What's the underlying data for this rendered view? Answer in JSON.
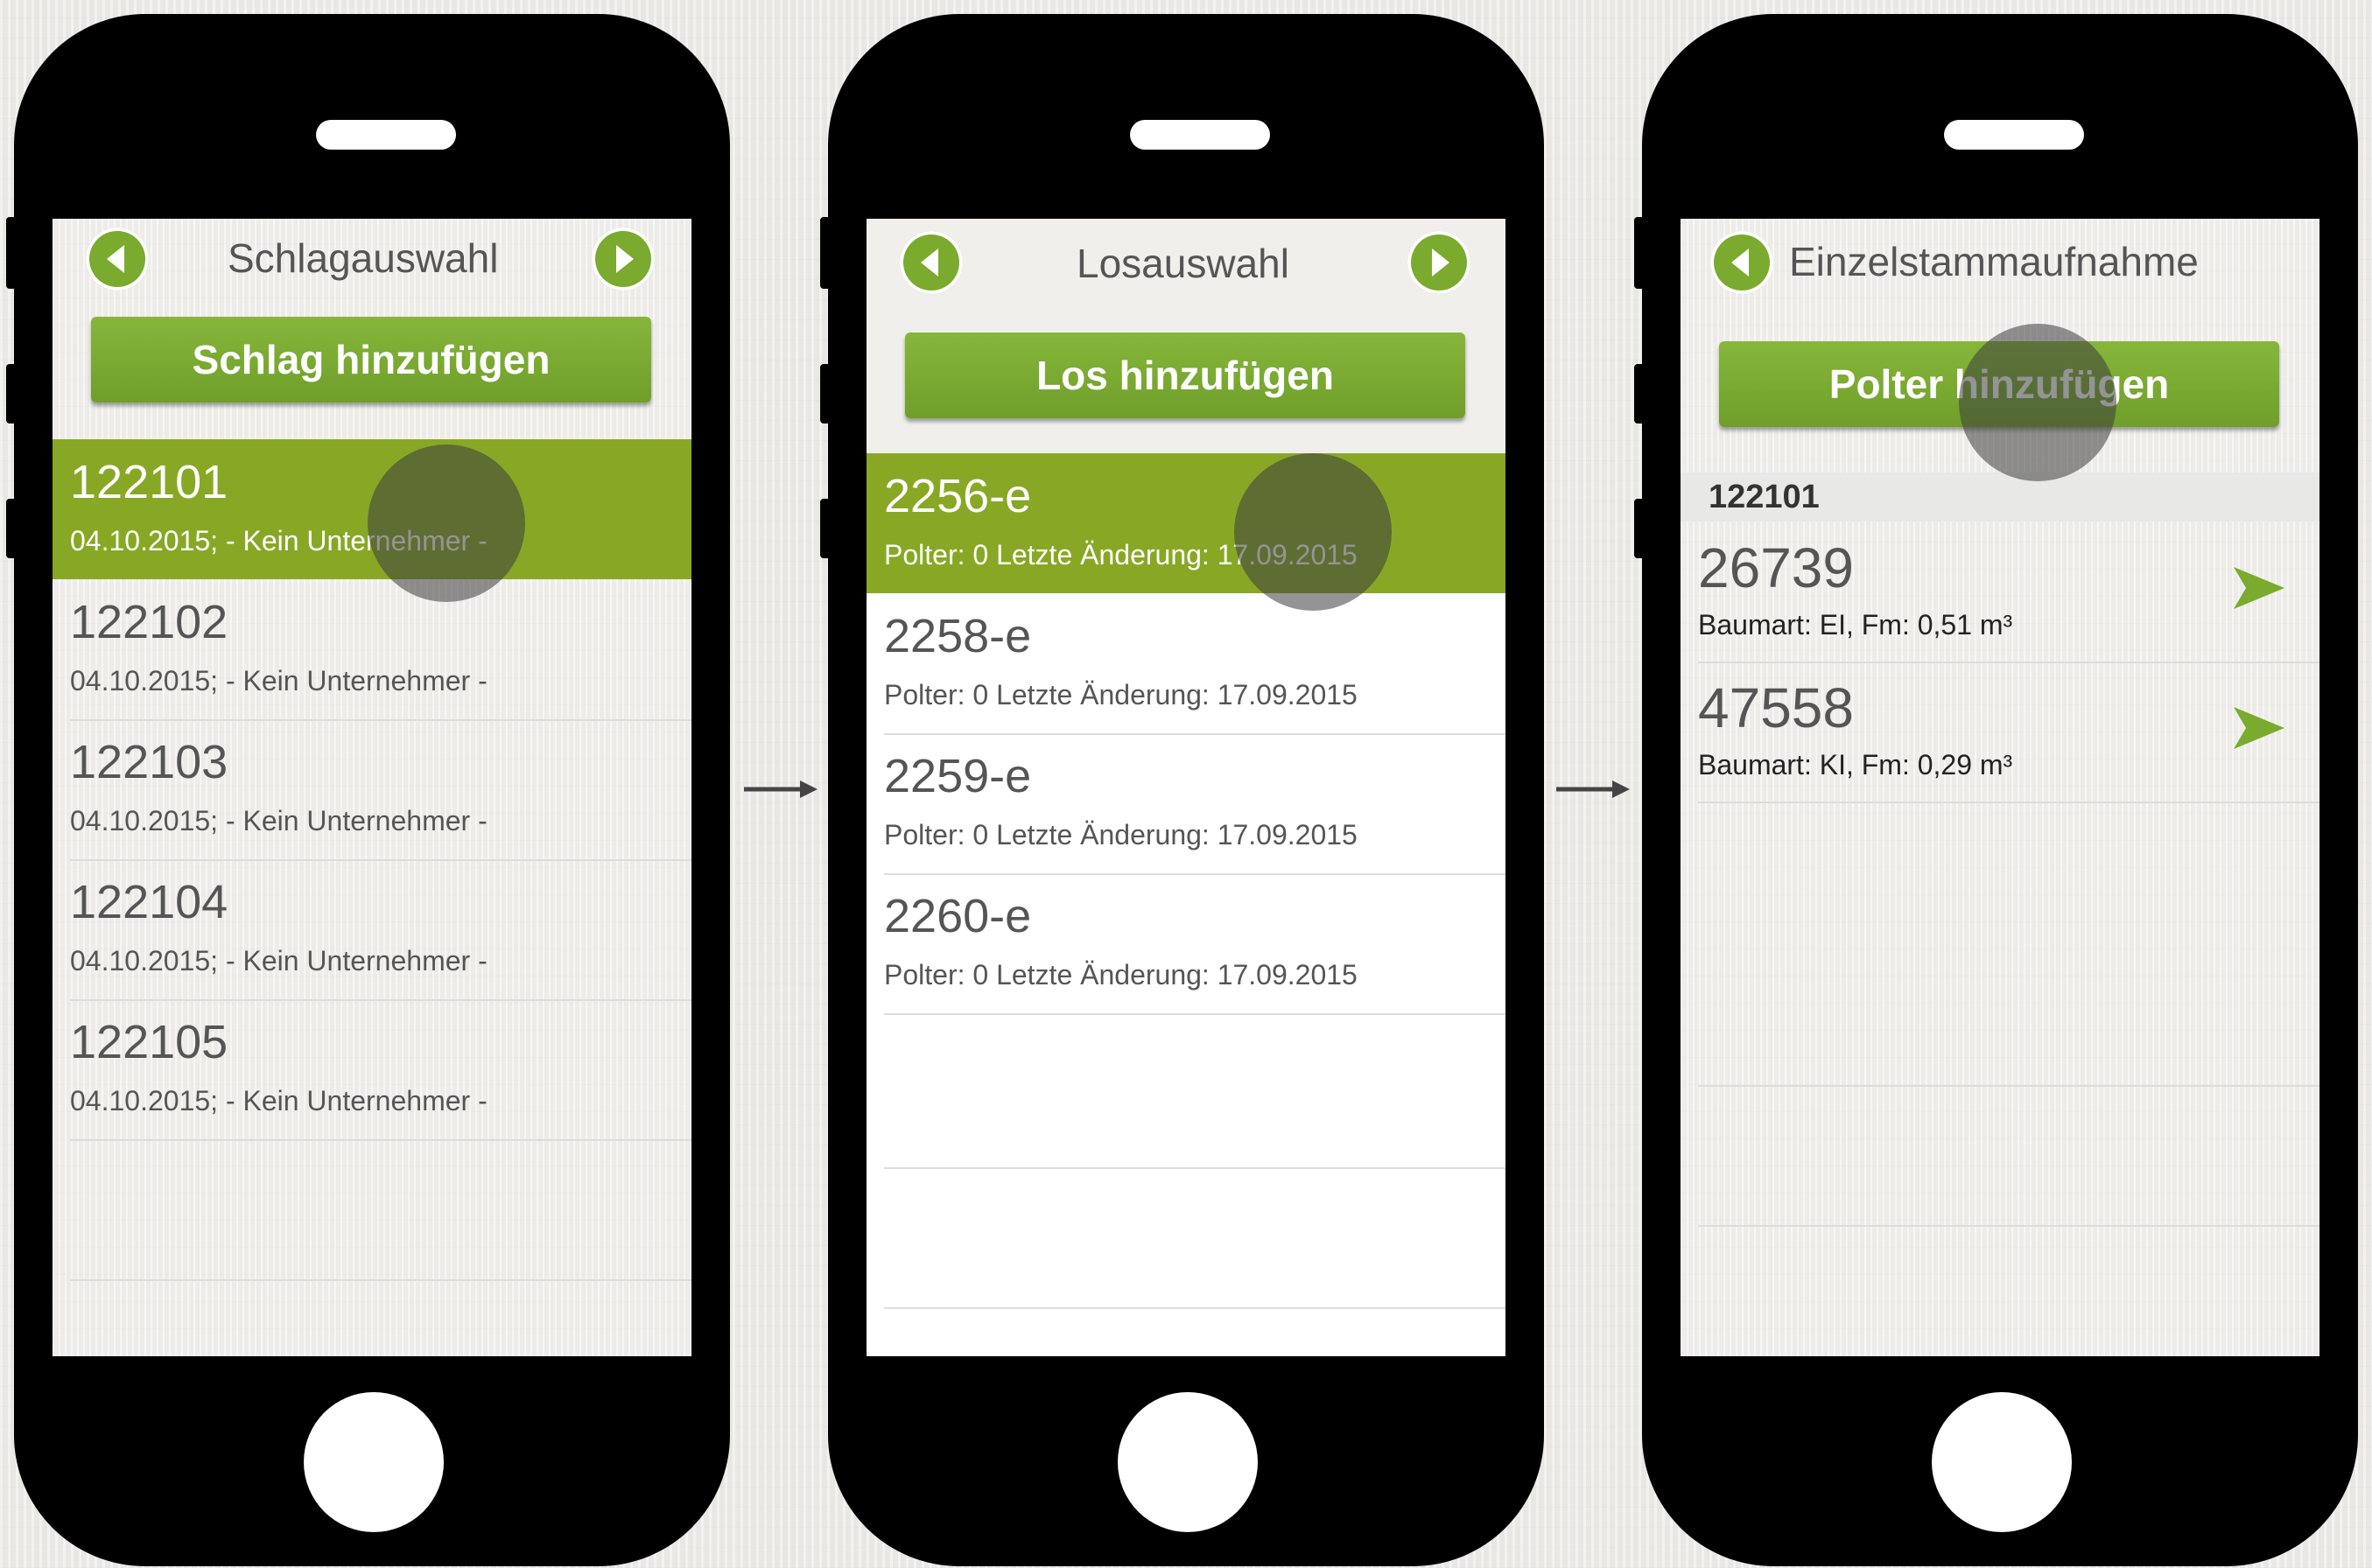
{
  "colors": {
    "accent_green": "#7aab2e",
    "selected_row": "#88a825",
    "touch_indicator": "#3c3c3c"
  },
  "phones": [
    {
      "title": "Schlagauswahl",
      "back_icon": "chevron-left-circle-icon",
      "forward_icon": "chevron-right-circle-icon",
      "add_button": "Schlag hinzufügen",
      "rows": [
        {
          "number": "122101",
          "detail": "04.10.2015; - Kein Unternehmer -",
          "selected": true
        },
        {
          "number": "122102",
          "detail": "04.10.2015; - Kein Unternehmer -",
          "selected": false
        },
        {
          "number": "122103",
          "detail": "04.10.2015; - Kein Unternehmer -",
          "selected": false
        },
        {
          "number": "122104",
          "detail": "04.10.2015; - Kein Unternehmer -",
          "selected": false
        },
        {
          "number": "122105",
          "detail": "04.10.2015; - Kein Unternehmer -",
          "selected": false
        }
      ]
    },
    {
      "title": "Losauswahl",
      "back_icon": "chevron-left-circle-icon",
      "forward_icon": "chevron-right-circle-icon",
      "add_button": "Los hinzufügen",
      "rows": [
        {
          "number": "2256-e",
          "detail": "Polter: 0 Letzte Änderung: 17.09.2015",
          "selected": true
        },
        {
          "number": "2258-e",
          "detail": "Polter: 0 Letzte Änderung: 17.09.2015",
          "selected": false
        },
        {
          "number": "2259-e",
          "detail": "Polter: 0 Letzte Änderung: 17.09.2015",
          "selected": false
        },
        {
          "number": "2260-e",
          "detail": "Polter: 0 Letzte Änderung: 17.09.2015",
          "selected": false
        }
      ]
    },
    {
      "title": "Einzelstammaufnahme",
      "back_icon": "chevron-left-circle-icon",
      "add_button": "Polter hinzufügen",
      "section": "122101",
      "rows": [
        {
          "number": "26739",
          "detail": "Baumart: EI, Fm: 0,51 m³",
          "arrow_icon": "arrow-right-icon"
        },
        {
          "number": "47558",
          "detail": "Baumart: KI, Fm: 0,29 m³",
          "arrow_icon": "arrow-right-icon"
        }
      ]
    }
  ]
}
